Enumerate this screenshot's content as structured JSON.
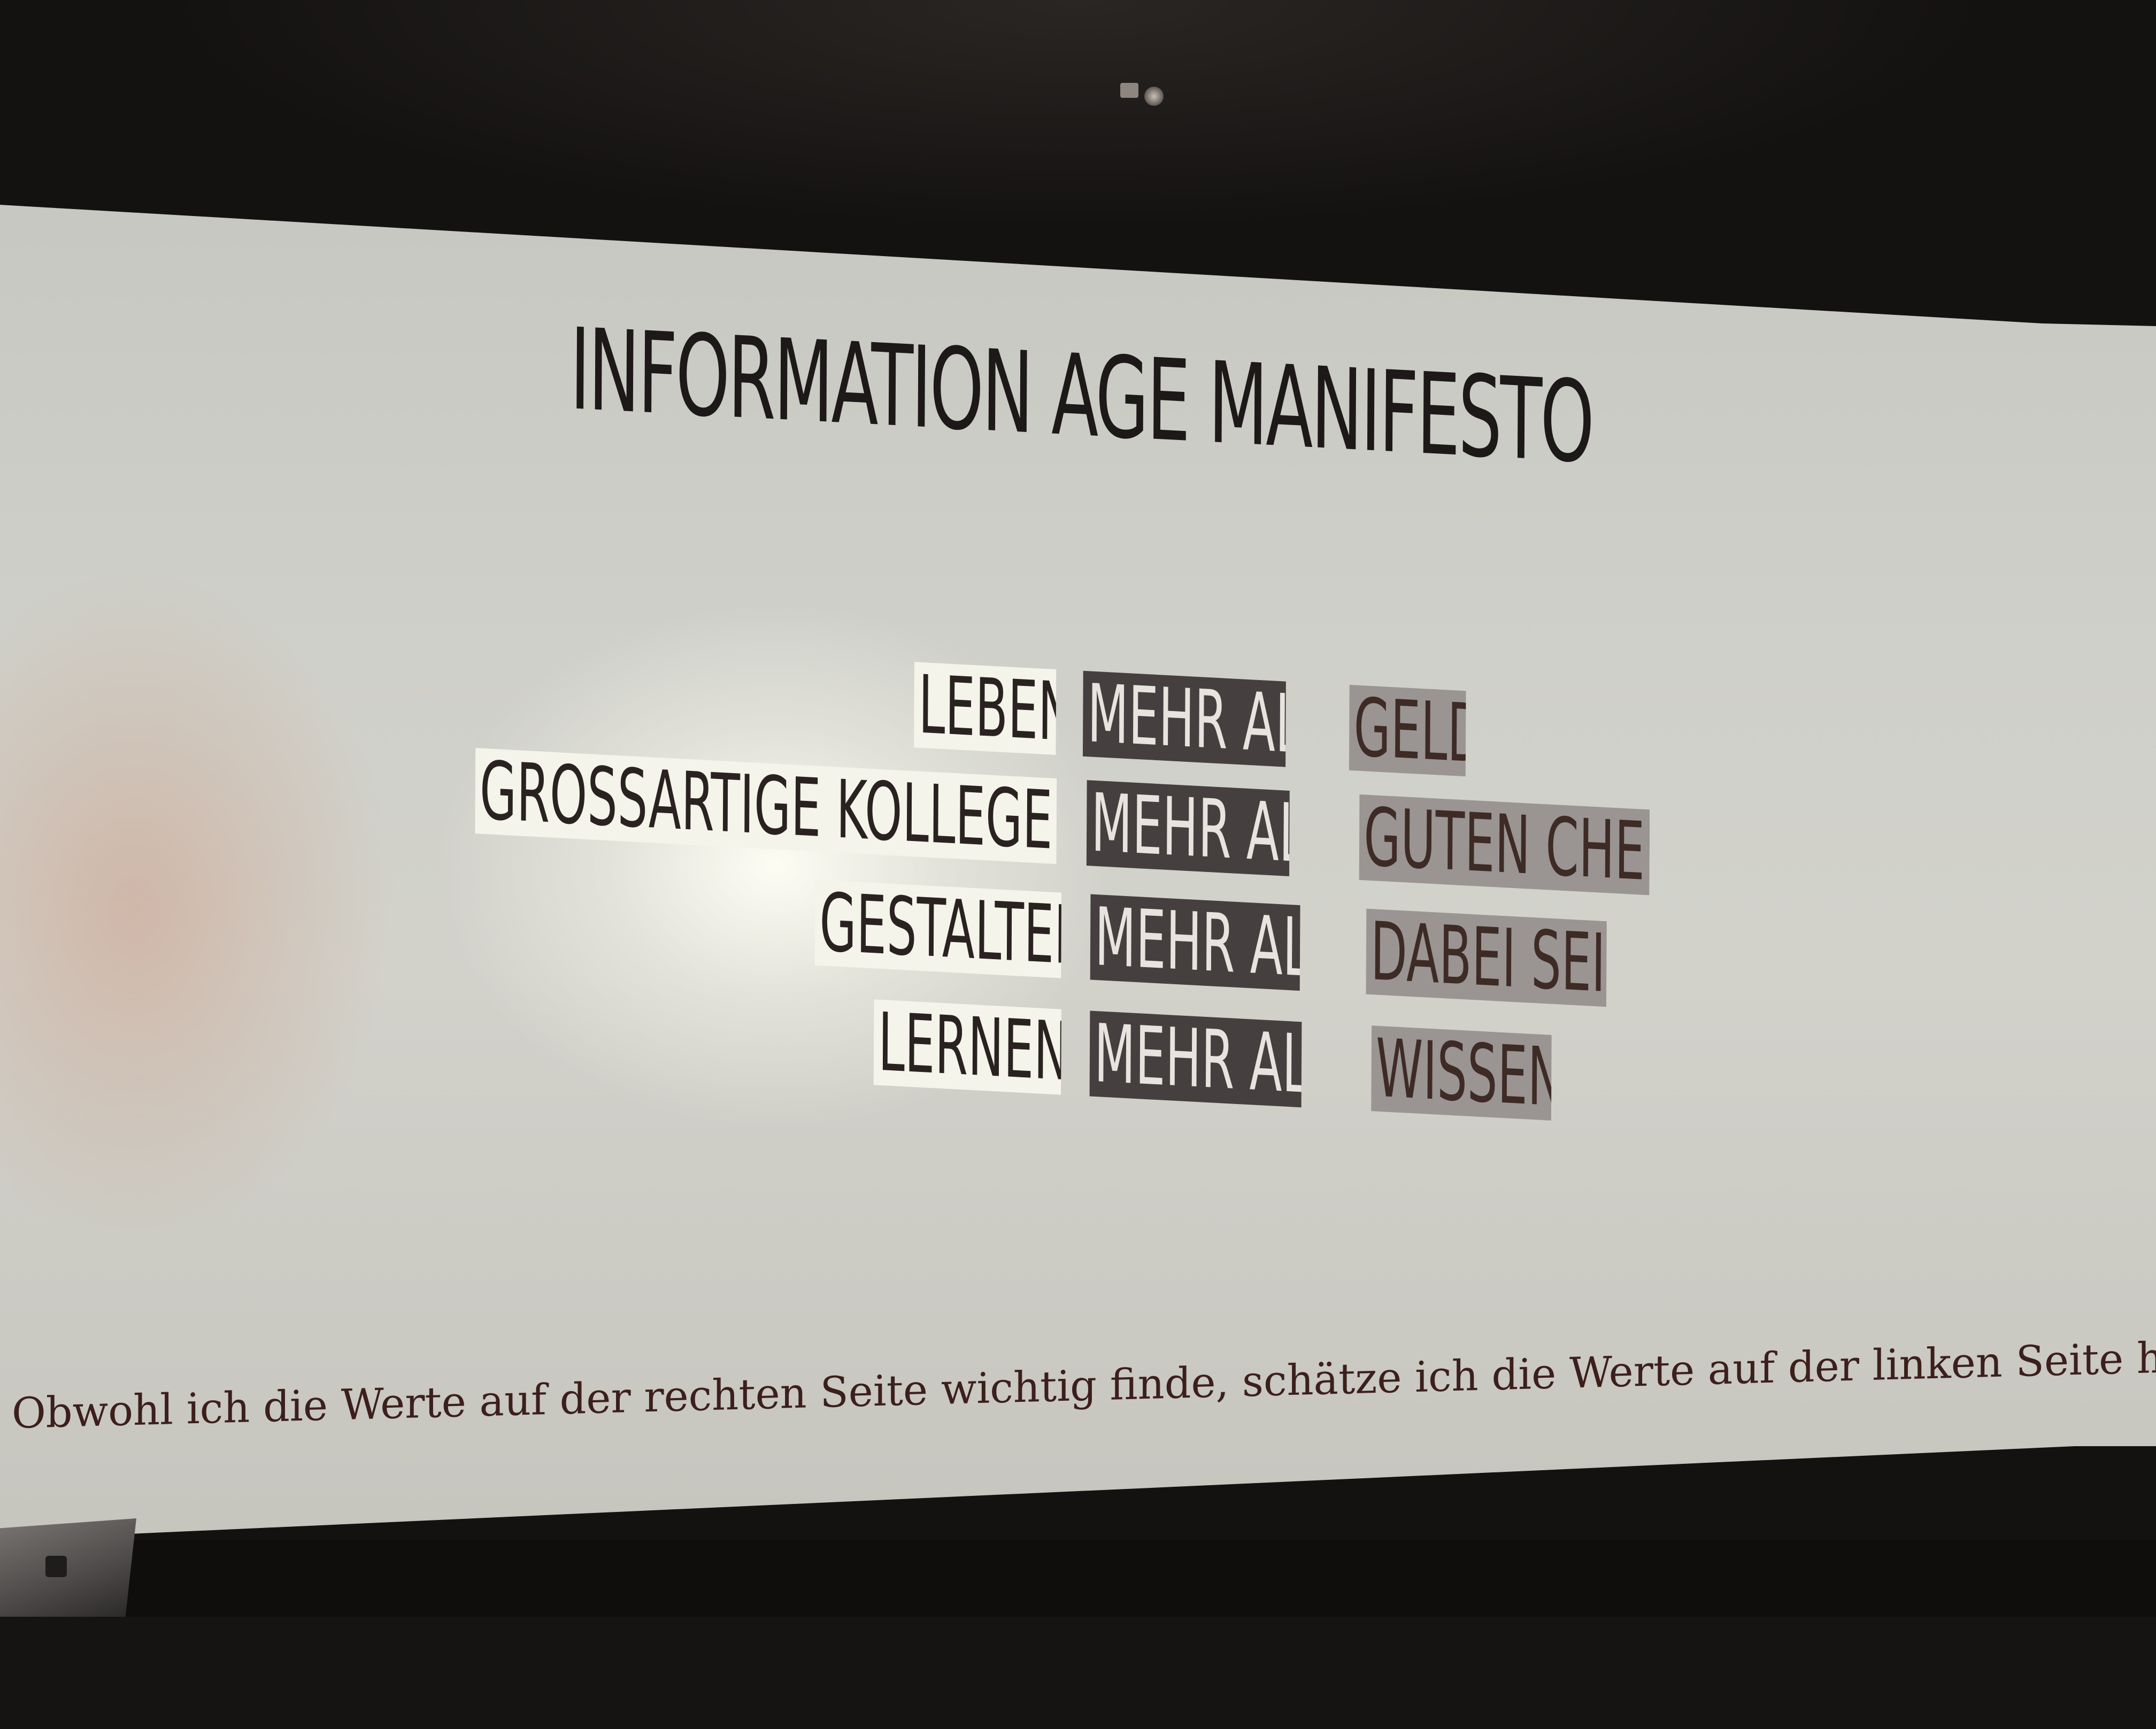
{
  "slide": {
    "title": "INFORMATION AGE MANIFESTO",
    "rows": [
      {
        "left": "LEBEN",
        "middle": "MEHR ALS",
        "right": "GELD"
      },
      {
        "left": "GROSSARTIGE KOLLEGEN",
        "middle": "MEHR ALS",
        "right": "GUTEN CHEF"
      },
      {
        "left": "GESTALTEN",
        "middle": "MEHR ALS",
        "right": "DABEI SEIN"
      },
      {
        "left": "LERNEN",
        "middle": "MEHR ALS",
        "right": "WISSEN"
      }
    ],
    "footer": "Obwohl ich die Werte auf der rechten Seite wichtig finde, schätze ich die Werte auf der linken Seite höher ein."
  },
  "colors": {
    "left_box": "#f4f4ea",
    "middle_box": "#45403f",
    "right_box": "#9a9592",
    "text_dark": "#1c1918",
    "footer_text": "#3c1f1c"
  }
}
